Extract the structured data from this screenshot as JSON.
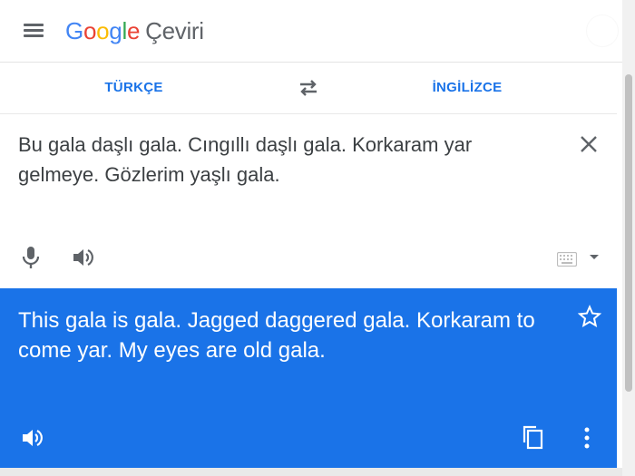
{
  "app": {
    "logo_parts": [
      {
        "char": "G",
        "color": "#4285F4"
      },
      {
        "char": "o",
        "color": "#EA4335"
      },
      {
        "char": "o",
        "color": "#FBBC05"
      },
      {
        "char": "g",
        "color": "#4285F4"
      },
      {
        "char": "l",
        "color": "#34A853"
      },
      {
        "char": "e",
        "color": "#EA4335"
      }
    ],
    "product_name": "Çeviri"
  },
  "languages": {
    "source": "TÜRKÇE",
    "target": "İNGİLİZCE"
  },
  "source_panel": {
    "text": "Bu gala daşlı gala. Cıngıllı daşlı gala. Korkaram yar gelmeye. Gözlerim yaşlı gala."
  },
  "result_panel": {
    "text": "This gala is gala. Jagged daggered gala. Korkaram to come yar. My eyes are old gala."
  },
  "colors": {
    "accent": "#1a73e8",
    "icon_gray": "#5f6368",
    "result_bg": "#1a73e8"
  },
  "icons": {
    "menu": "menu-icon",
    "swap": "swap-languages-icon",
    "clear": "close-icon",
    "mic": "microphone-icon",
    "speaker": "speaker-icon",
    "keyboard": "keyboard-icon",
    "star": "star-icon",
    "copy": "copy-icon",
    "more": "more-vertical-icon"
  }
}
